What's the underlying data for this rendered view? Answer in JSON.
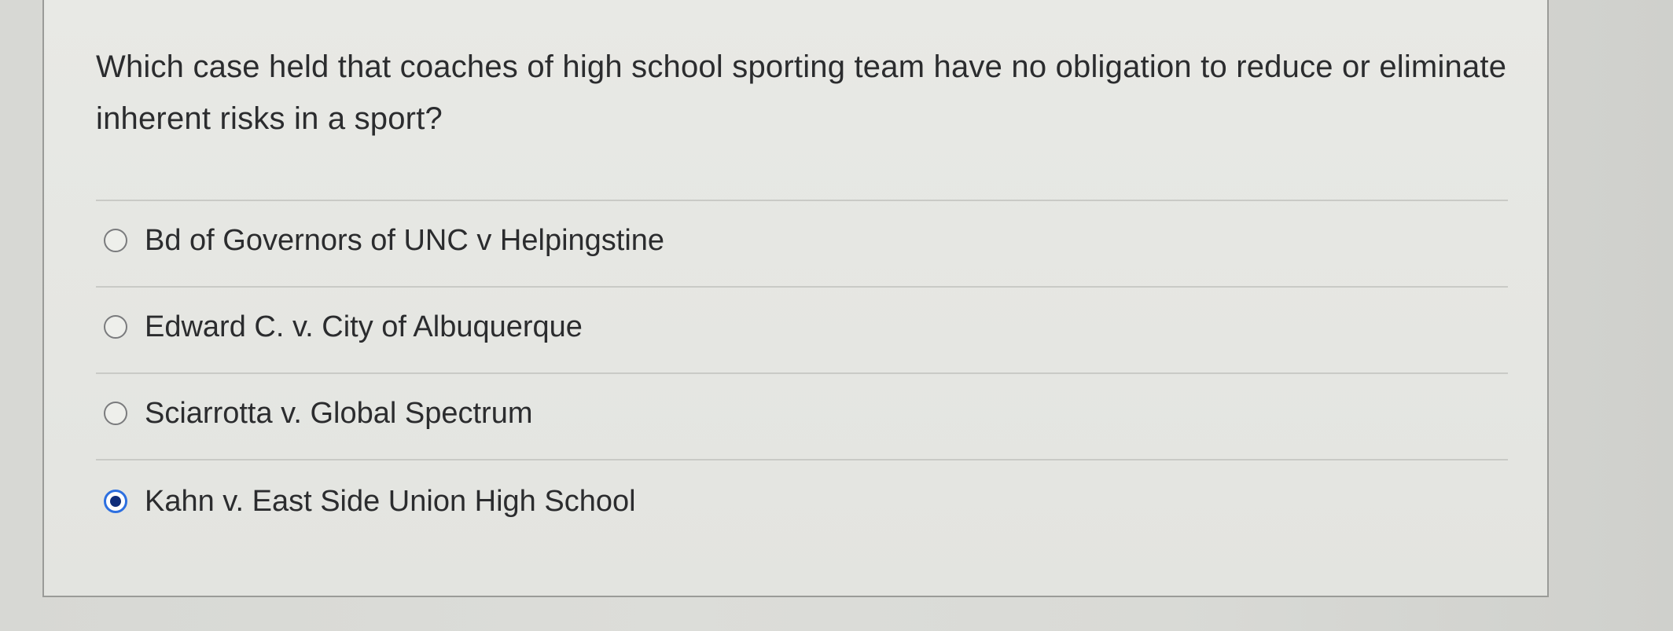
{
  "question": {
    "text": "Which case held that coaches of high school sporting team have no obligation to reduce or eliminate inherent risks in a sport?"
  },
  "options": [
    {
      "label": "Bd of Governors of UNC v Helpingstine",
      "selected": false
    },
    {
      "label": "Edward C. v. City of Albuquerque",
      "selected": false
    },
    {
      "label": "Sciarrotta v. Global Spectrum",
      "selected": false
    },
    {
      "label": "Kahn v. East Side Union High School",
      "selected": true
    }
  ],
  "colors": {
    "selected_radio_ring": "#2c6fe0",
    "selected_radio_dot": "#0f2d7a",
    "text": "#2b2c2e"
  }
}
